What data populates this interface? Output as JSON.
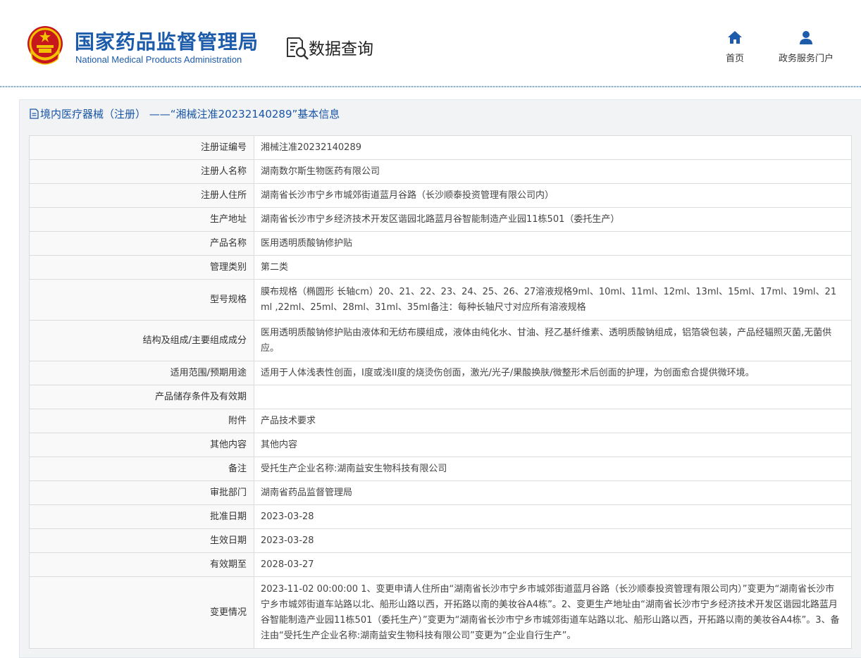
{
  "header": {
    "org_cn": "国家药品监督管理局",
    "org_en": "National Medical Products Administration",
    "page_title": "数据查询",
    "nav": [
      {
        "label": "首页",
        "icon": "home-icon"
      },
      {
        "label": "政务服务门户",
        "icon": "user-icon"
      }
    ],
    "brand_color": "#1d5bab"
  },
  "panel": {
    "title": "境内医疗器械（注册） ——“湘械注准20232140289”基本信息"
  },
  "rows": [
    {
      "key": "注册证编号",
      "value": "湘械注准20232140289"
    },
    {
      "key": "注册人名称",
      "value": "湖南数尔斯生物医药有限公司"
    },
    {
      "key": "注册人住所",
      "value": "湖南省长沙市宁乡市城郊街道蓝月谷路（长沙顺泰投资管理有限公司内）"
    },
    {
      "key": "生产地址",
      "value": "湖南省长沙市宁乡经济技术开发区谐园北路蓝月谷智能制造产业园11栋501（委托生产）"
    },
    {
      "key": "产品名称",
      "value": "医用透明质酸钠修护贴"
    },
    {
      "key": "管理类别",
      "value": "第二类"
    },
    {
      "key": "型号规格",
      "value": "膜布规格（椭圆形 长轴cm）20、21、22、23、24、25、26、27溶液规格9ml、10ml、11ml、12ml、13ml、15ml、17ml、19ml、21ml ,22ml、25ml、28ml、31ml、35ml备注：每种长轴尺寸对应所有溶液规格"
    },
    {
      "key": "结构及组成/主要组成成分",
      "value": "医用透明质酸钠修护贴由液体和无纺布膜组成，液体由纯化水、甘油、羟乙基纤维素、透明质酸钠组成，铝箔袋包装，产品经辐照灭菌,无菌供应。"
    },
    {
      "key": "适用范围/预期用途",
      "value": "适用于人体浅表性创面，I度或浅II度的烧烫伤创面，激光/光子/果酸换肤/微整形术后创面的护理，为创面愈合提供微环境。"
    },
    {
      "key": "产品储存条件及有效期",
      "value": ""
    },
    {
      "key": "附件",
      "value": "产品技术要求"
    },
    {
      "key": "其他内容",
      "value": "其他内容"
    },
    {
      "key": "备注",
      "value": "受托生产企业名称:湖南益安生物科技有限公司"
    },
    {
      "key": "审批部门",
      "value": "湖南省药品监督管理局"
    },
    {
      "key": "批准日期",
      "value": "2023-03-28"
    },
    {
      "key": "生效日期",
      "value": "2023-03-28"
    },
    {
      "key": "有效期至",
      "value": "2028-03-27"
    },
    {
      "key": "变更情况",
      "value": "2023-11-02 00:00:00 1、变更申请人住所由“湖南省长沙市宁乡市城郊街道蓝月谷路（长沙顺泰投资管理有限公司内）”变更为“湖南省长沙市宁乡市城郊街道车站路以北、船形山路以西，开拓路以南的美妆谷A4栋”。2、变更生产地址由“湖南省长沙市宁乡经济技术开发区谐园北路蓝月谷智能制造产业园11栋501（委托生产）”变更为“湖南省长沙市宁乡市城郊街道车站路以北、船形山路以西，开拓路以南的美妆谷A4栋”。3、备注由“受托生产企业名称:湖南益安生物科技有限公司”变更为“企业自行生产”。"
    }
  ]
}
